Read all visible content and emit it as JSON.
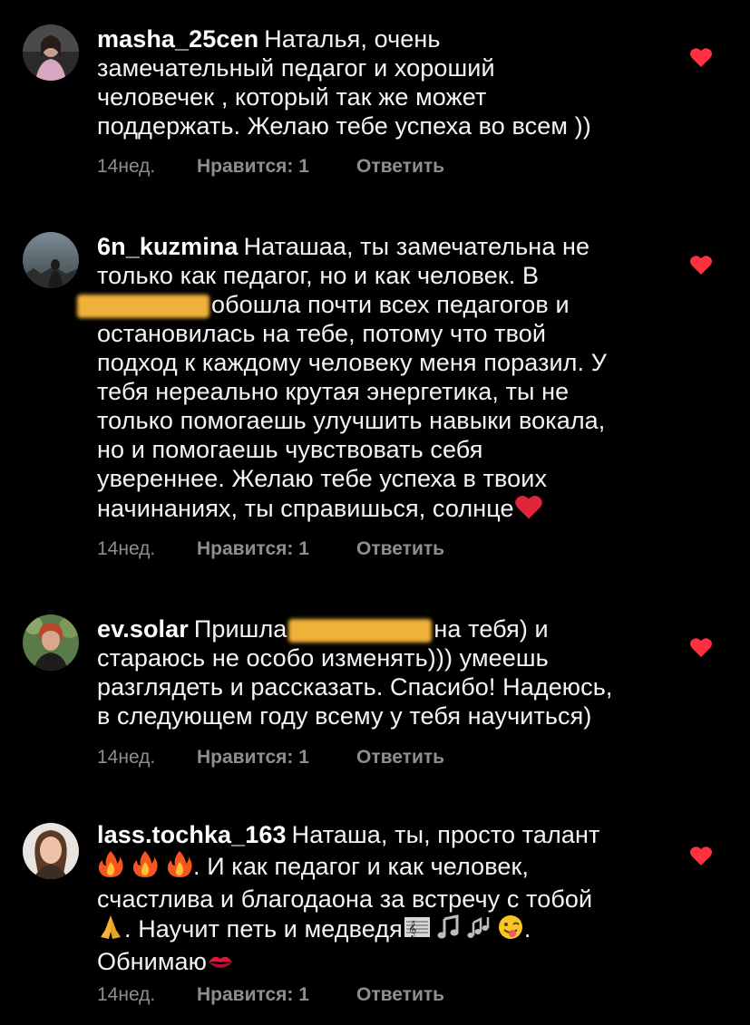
{
  "comments": [
    {
      "username": "masha_25cen",
      "lines": [
        "Наталья,  очень",
        "замечательный педагог и хороший",
        "человечек , который так же может",
        "поддержать. Желаю тебе успеха во всем ))"
      ],
      "time_ago": "14нед.",
      "likes": "Нравится: 1",
      "reply": "Ответить",
      "heart_color": "#ff3040"
    },
    {
      "username": "6n_kuzmina",
      "line1": "Наташаа, ты замечательна не",
      "line2": "только как педагог, но и как человек. В",
      "line3": "обошла почти всех педагогов и",
      "rest": "остановилась на тебе, потому что твой\nподход к каждому человеку меня поразил. У\nтебя нереально крутая энергетика, ты не\nтолько помогаешь улучшить навыки вокала,\nно и помогаешь чувствовать себя\nувереннее. Желаю тебе успеха в твоих",
      "last": "начинаниях, ты справишься, солнце",
      "time_ago": "14нед.",
      "likes": "Нравится: 1",
      "reply": "Ответить"
    },
    {
      "username": "ev.solar",
      "line1a": "Пришла",
      "line1b": "на тебя) и",
      "rest": "стараюсь не особо изменять))) умеешь\nразглядеть и рассказать. Спасибо! Надеюсь,\nв следующем году всему у тебя научиться)",
      "time_ago": "14нед.",
      "likes": "Нравится: 1",
      "reply": "Ответить"
    },
    {
      "username": "lass.tochka_163",
      "line1": "Наташа, ты, просто талант",
      "line2": ". И как педагог и как человек,",
      "line3": "счастлива и благодаона за встречу с тобой",
      "line4": ". Научит петь и медведя",
      "line4end": ".",
      "line5": "Обнимаю",
      "time_ago": "14нед.",
      "likes": "Нравится: 1",
      "reply": "Ответить"
    }
  ]
}
